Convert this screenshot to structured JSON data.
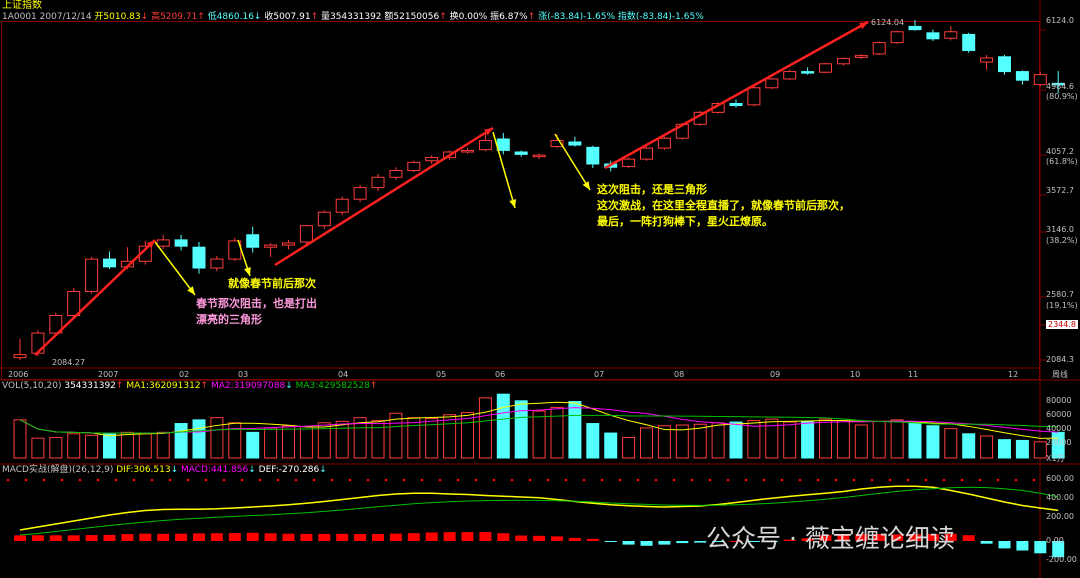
{
  "header": {
    "title": "上证指数",
    "code": "1A0001",
    "date": "2007/12/14",
    "open": "开5010.83",
    "high": "高5209.71",
    "low": "低4860.16",
    "close": "收5007.91",
    "volume": "量354331392",
    "amount": "额52150056",
    "turnover": "换0.00%",
    "amplitude": "振6.87%",
    "change": "涨(-83.84)-1.65%",
    "index_change": "指数(-83.84)-1.65%"
  },
  "annotations": {
    "a1": "就像春节前后那次",
    "a2_line1": "春节那次阻击，也是打出",
    "a2_line2": "漂亮的三角形",
    "a3_line1": "这次阻击，还是三角形",
    "a3_line2": "这次激战，在这里全程直播了，就像春节前后那次，",
    "a3_line3": "最后，一阵打狗棒下，星火正燎原。"
  },
  "price_labels": {
    "high": "6124.04",
    "low": "2084.27"
  },
  "y_axis": [
    {
      "label": "6124.0",
      "pct": ""
    },
    {
      "label": "4984.6",
      "pct": "(80.9%)"
    },
    {
      "label": "4057.2",
      "pct": "(61.8%)"
    },
    {
      "label": "3572.7",
      "pct": ""
    },
    {
      "label": "3146.0",
      "pct": "(38.2%)"
    },
    {
      "label": "2580.7",
      "pct": "(19.1%)"
    },
    {
      "label": "2344.8",
      "pct": ""
    },
    {
      "label": "2084.3",
      "pct": ""
    }
  ],
  "x_axis": [
    "2006",
    "2007",
    "02",
    "03",
    "04",
    "05",
    "06",
    "07",
    "08",
    "09",
    "10",
    "11",
    "12"
  ],
  "x_axis_unit": "周线",
  "vol": {
    "title": "VOL(5,10,20)",
    "value": "354331392",
    "ma1": "MA1:362091312",
    "ma2": "MA2:319097088",
    "ma3": "MA3:429582528",
    "axis": [
      "80000",
      "60000",
      "40000",
      "20000"
    ],
    "unit": "X1万"
  },
  "macd": {
    "title": "MACD实战(解盘)",
    "params": "(26,12,9)",
    "dif": "DIF:306.513",
    "macd": "MACD:441.856",
    "def": "DEF:-270.286",
    "axis": [
      "600.00",
      "400.00",
      "200.00",
      "0.00",
      "-200.00"
    ]
  },
  "watermark": "公众号 · 薇宝缠论细读",
  "colors": {
    "up": "#ff3c3c",
    "down": "#54ffff",
    "ma1": "#ffff00",
    "ma2": "#ff00ff",
    "ma3": "#00c000",
    "arrow_red": "#ff2020",
    "arrow_yellow": "#ffff00"
  },
  "chart_data": {
    "type": "candlestick",
    "title": "上证指数",
    "period": "weekly",
    "ylim": [
      2084.27,
      6124.04
    ],
    "candles": [
      {
        "o": 2100,
        "c": 2120,
        "h": 2230,
        "l": 2084
      },
      {
        "o": 2130,
        "c": 2270,
        "h": 2290,
        "l": 2110
      },
      {
        "o": 2270,
        "c": 2400,
        "h": 2420,
        "l": 2250
      },
      {
        "o": 2400,
        "c": 2590,
        "h": 2620,
        "l": 2380
      },
      {
        "o": 2590,
        "c": 2870,
        "h": 2890,
        "l": 2570
      },
      {
        "o": 2870,
        "c": 2800,
        "h": 2940,
        "l": 2780
      },
      {
        "o": 2800,
        "c": 2850,
        "h": 2980,
        "l": 2780
      },
      {
        "o": 2850,
        "c": 2990,
        "h": 3040,
        "l": 2820
      },
      {
        "o": 2990,
        "c": 3050,
        "h": 3100,
        "l": 2960
      },
      {
        "o": 3050,
        "c": 2990,
        "h": 3100,
        "l": 2950
      },
      {
        "o": 2980,
        "c": 2790,
        "h": 3030,
        "l": 2740
      },
      {
        "o": 2790,
        "c": 2870,
        "h": 2900,
        "l": 2760
      },
      {
        "o": 2870,
        "c": 3040,
        "h": 3070,
        "l": 2850
      },
      {
        "o": 3100,
        "c": 2980,
        "h": 3180,
        "l": 2930
      },
      {
        "o": 2980,
        "c": 3000,
        "h": 3020,
        "l": 2890
      },
      {
        "o": 3000,
        "c": 3020,
        "h": 3050,
        "l": 2960
      },
      {
        "o": 3030,
        "c": 3190,
        "h": 3200,
        "l": 3010
      },
      {
        "o": 3190,
        "c": 3330,
        "h": 3350,
        "l": 3160
      },
      {
        "o": 3330,
        "c": 3470,
        "h": 3500,
        "l": 3300
      },
      {
        "o": 3470,
        "c": 3600,
        "h": 3630,
        "l": 3440
      },
      {
        "o": 3600,
        "c": 3720,
        "h": 3760,
        "l": 3560
      },
      {
        "o": 3720,
        "c": 3800,
        "h": 3840,
        "l": 3690
      },
      {
        "o": 3800,
        "c": 3900,
        "h": 3920,
        "l": 3780
      },
      {
        "o": 3920,
        "c": 3960,
        "h": 3990,
        "l": 3880
      },
      {
        "o": 3960,
        "c": 4030,
        "h": 4050,
        "l": 3930
      },
      {
        "o": 4030,
        "c": 4050,
        "h": 4080,
        "l": 4010
      },
      {
        "o": 4060,
        "c": 4180,
        "h": 4270,
        "l": 4040
      },
      {
        "o": 4200,
        "c": 4050,
        "h": 4280,
        "l": 4000
      },
      {
        "o": 4030,
        "c": 4000,
        "h": 4050,
        "l": 3970
      },
      {
        "o": 3990,
        "c": 3990,
        "h": 4010,
        "l": 3940
      },
      {
        "o": 4100,
        "c": 4180,
        "h": 4260,
        "l": 4080
      },
      {
        "o": 4160,
        "c": 4120,
        "h": 4230,
        "l": 4100
      },
      {
        "o": 4090,
        "c": 3880,
        "h": 4110,
        "l": 3830
      },
      {
        "o": 3880,
        "c": 3840,
        "h": 3920,
        "l": 3790
      },
      {
        "o": 3850,
        "c": 3940,
        "h": 3960,
        "l": 3830
      },
      {
        "o": 3940,
        "c": 4080,
        "h": 4100,
        "l": 3920
      },
      {
        "o": 4080,
        "c": 4210,
        "h": 4230,
        "l": 4060
      },
      {
        "o": 4210,
        "c": 4400,
        "h": 4420,
        "l": 4190
      },
      {
        "o": 4400,
        "c": 4570,
        "h": 4590,
        "l": 4380
      },
      {
        "o": 4570,
        "c": 4700,
        "h": 4720,
        "l": 4550
      },
      {
        "o": 4700,
        "c": 4670,
        "h": 4760,
        "l": 4640
      },
      {
        "o": 4680,
        "c": 4940,
        "h": 4970,
        "l": 4660
      },
      {
        "o": 4940,
        "c": 5080,
        "h": 5100,
        "l": 4920
      },
      {
        "o": 5080,
        "c": 5200,
        "h": 5230,
        "l": 5060
      },
      {
        "o": 5200,
        "c": 5190,
        "h": 5270,
        "l": 5150
      },
      {
        "o": 5190,
        "c": 5330,
        "h": 5350,
        "l": 5170
      },
      {
        "o": 5330,
        "c": 5420,
        "h": 5440,
        "l": 5300
      },
      {
        "o": 5440,
        "c": 5470,
        "h": 5500,
        "l": 5410
      },
      {
        "o": 5500,
        "c": 5700,
        "h": 5720,
        "l": 5480
      },
      {
        "o": 5700,
        "c": 5900,
        "h": 5920,
        "l": 5680
      },
      {
        "o": 6000,
        "c": 5940,
        "h": 6124.04,
        "l": 5920
      },
      {
        "o": 5880,
        "c": 5770,
        "h": 5940,
        "l": 5730
      },
      {
        "o": 5780,
        "c": 5900,
        "h": 6010,
        "l": 5740
      },
      {
        "o": 5850,
        "c": 5560,
        "h": 5880,
        "l": 5520
      },
      {
        "o": 5360,
        "c": 5430,
        "h": 5480,
        "l": 5230
      },
      {
        "o": 5450,
        "c": 5200,
        "h": 5480,
        "l": 5150
      },
      {
        "o": 5200,
        "c": 5060,
        "h": 5220,
        "l": 4990
      },
      {
        "o": 4990,
        "c": 5150,
        "h": 5200,
        "l": 4960
      },
      {
        "o": 5010,
        "c": 5008,
        "h": 5210,
        "l": 4860
      }
    ],
    "volume": [
      52000,
      27000,
      28000,
      33000,
      31000,
      33000,
      35000,
      33000,
      35000,
      47000,
      52000,
      55000,
      48000,
      35000,
      41000,
      44000,
      43000,
      48000,
      50000,
      55000,
      51000,
      61000,
      55000,
      54000,
      59000,
      62000,
      82000,
      87000,
      78000,
      64000,
      69000,
      77000,
      47000,
      34000,
      28000,
      41000,
      44000,
      45000,
      46000,
      48000,
      49000,
      51000,
      53000,
      49000,
      50000,
      53000,
      51000,
      45000,
      50000,
      52000,
      47000,
      44000,
      40000,
      33000,
      30000,
      25000,
      24000,
      22000,
      35000
    ],
    "macd_hist": [
      56,
      57,
      57,
      57,
      59,
      61,
      69,
      74,
      72,
      73,
      76,
      78,
      80,
      82,
      77,
      73,
      71,
      71,
      72,
      70,
      70,
      74,
      78,
      85,
      88,
      88,
      90,
      78,
      55,
      52,
      46,
      31,
      22,
      -5,
      -36,
      -48,
      -36,
      -21,
      -16,
      -8,
      1,
      -2,
      -1,
      13,
      27,
      59,
      67,
      69,
      71,
      66,
      68,
      70,
      72,
      58,
      -27,
      -74,
      -95,
      -123,
      -162
    ],
    "dif": [
      110,
      140,
      170,
      200,
      230,
      260,
      285,
      305,
      315,
      318,
      318,
      322,
      330,
      340,
      350,
      362,
      378,
      395,
      415,
      435,
      455,
      470,
      478,
      478,
      470,
      465,
      455,
      448,
      440,
      432,
      415,
      395,
      378,
      362,
      352,
      345,
      340,
      345,
      350,
      365,
      385,
      408,
      428,
      446,
      463,
      478,
      495,
      520,
      538,
      548,
      547,
      538,
      505,
      470,
      430,
      390,
      355,
      330,
      306.5
    ],
    "dea": [
      60,
      75,
      95,
      115,
      135,
      155,
      172,
      190,
      205,
      218,
      228,
      237,
      246,
      255,
      263,
      272,
      283,
      296,
      310,
      326,
      342,
      358,
      372,
      384,
      393,
      400,
      404,
      406,
      407,
      406,
      403,
      397,
      390,
      380,
      372,
      366,
      360,
      357,
      356,
      358,
      362,
      369,
      378,
      389,
      402,
      418,
      435,
      455,
      476,
      496,
      512,
      522,
      532,
      537,
      534,
      522,
      505,
      478,
      441.9
    ]
  }
}
